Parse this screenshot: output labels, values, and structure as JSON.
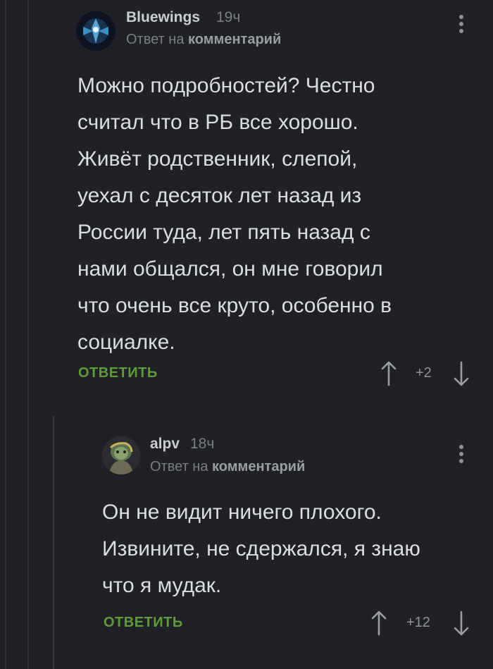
{
  "comments": [
    {
      "author": "Bluewings",
      "time": "19ч",
      "reply_prefix": "Ответ на",
      "reply_target": "комментарий",
      "lines": [
        "Можно подробностей? Честно",
        "считал что в РБ все хорошо.",
        "Живёт родственник, слепой,",
        "уехал с десяток лет назад из",
        "России туда, лет пять назад с",
        "нами общался, он мне говорил",
        "что очень все круто, особенно в",
        "социалке."
      ],
      "reply_label": "ОТВЕТИТЬ",
      "score": "+2"
    },
    {
      "author": "alpv",
      "time": "18ч",
      "reply_prefix": "Ответ на",
      "reply_target": "комментарий",
      "lines": [
        "Он не видит ничего плохого.",
        "Извините, не сдержался, я знаю",
        "что я мудак."
      ],
      "reply_label": "ОТВЕТИТЬ",
      "score": "+12"
    }
  ],
  "icons": {
    "upvote": "arrow-up-icon",
    "downvote": "arrow-down-icon",
    "menu": "more-vertical-icon"
  },
  "colors": {
    "background": "#1f2126",
    "reply_button": "#5f9a3b",
    "text": "#dadde1",
    "muted": "#7a7e85"
  }
}
